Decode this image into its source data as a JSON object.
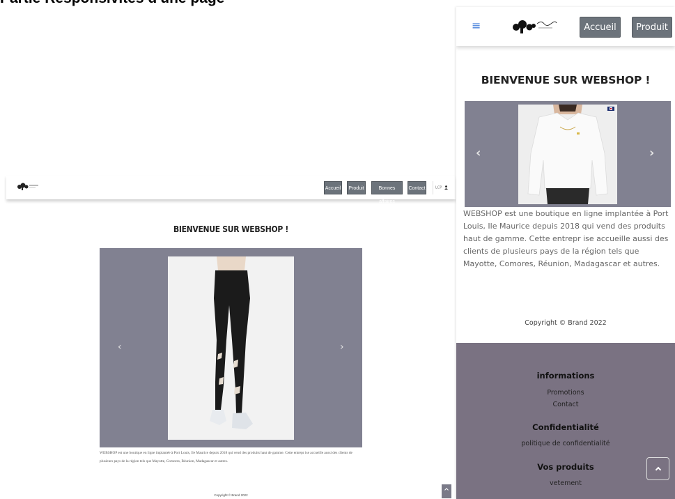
{
  "page": {
    "title": "Partie Responsivités d'une page"
  },
  "desktop": {
    "nav": {
      "items": [
        "Accueil",
        "Produit",
        "Bonnes affaires",
        "Contact"
      ],
      "right_text": "LCP",
      "right_icon": "user-icon"
    },
    "heading": "BIENVENUE SUR WEBSHOP !",
    "carousel": {
      "prev": "‹",
      "next": "›",
      "image": "black-jeans-model"
    },
    "description": "WEBSHOP est une boutique en ligne implantée à Port Louis, Ile Maurice depuis 2018 qui vend des produits haut de gamme. Cette entrepr ise accueille aussi des clients de plusieurs pays de la région tels que Mayotte, Comores, Réunion, Madagascar et autres.",
    "copyright": "Copyright © Brand 2022"
  },
  "mobile": {
    "nav": {
      "menu_icon": "≡",
      "items": [
        "Accueil",
        "Produit"
      ]
    },
    "heading": "BIENVENUE SUR WEBSHOP !",
    "carousel": {
      "prev": "‹",
      "next": "›",
      "image": "white-sweater-model"
    },
    "description": "WEBSHOP est une boutique en ligne implantée à Port Louis, Ile Maurice depuis 2018 qui vend des produits haut de gamme. Cette entrepr ise accueille aussi des clients de plusieurs pays de la région tels que Mayotte, Comores, Réunion, Madagascar et autres.",
    "copyright": "Copyright © Brand 2022",
    "footer": {
      "sections": [
        {
          "title": "informations",
          "links": [
            "Promotions",
            "Contact"
          ]
        },
        {
          "title": "Confidentialité",
          "links": [
            "politique de confidentialité"
          ]
        },
        {
          "title": "Vos produits",
          "links": [
            "vetement"
          ]
        }
      ]
    }
  },
  "colors": {
    "carousel_bg": "#818191",
    "button_bg": "#6c737b",
    "footer_bg": "#7a7282",
    "menu_icon": "#2f6fd6"
  }
}
